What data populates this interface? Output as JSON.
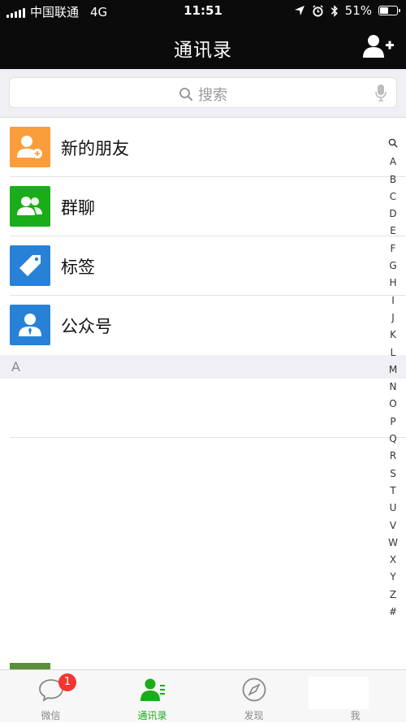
{
  "status_bar": {
    "carrier": "中国联通",
    "network": "4G",
    "time": "11:51",
    "battery": "51%",
    "battery_level": 0.51
  },
  "nav": {
    "title": "通讯录",
    "add_icon": "add-friend-icon"
  },
  "search": {
    "placeholder": "搜索",
    "icon": "search-icon",
    "mic_icon": "microphone-icon"
  },
  "contacts": {
    "items": [
      {
        "label": "新的朋友",
        "icon": "new-friends-icon",
        "color": "#fa9d3b"
      },
      {
        "label": "群聊",
        "icon": "group-chat-icon",
        "color": "#1aad19"
      },
      {
        "label": "标签",
        "icon": "tag-icon",
        "color": "#2782d7"
      },
      {
        "label": "公众号",
        "icon": "official-account-icon",
        "color": "#2782d7"
      }
    ],
    "section_a": "A"
  },
  "index": [
    "A",
    "B",
    "C",
    "D",
    "E",
    "F",
    "G",
    "H",
    "I",
    "J",
    "K",
    "L",
    "M",
    "N",
    "O",
    "P",
    "Q",
    "R",
    "S",
    "T",
    "U",
    "V",
    "W",
    "X",
    "Y",
    "Z",
    "#"
  ],
  "tabs": [
    {
      "label": "微信",
      "icon": "chat-bubble-icon",
      "badge": "1"
    },
    {
      "label": "通讯录",
      "icon": "contacts-icon"
    },
    {
      "label": "发现",
      "icon": "compass-icon"
    },
    {
      "label": "我",
      "icon": "me-icon"
    }
  ],
  "colors": {
    "accent": "#1aad19",
    "nav_bg": "#0b0b0b",
    "badge": "#f43530"
  }
}
